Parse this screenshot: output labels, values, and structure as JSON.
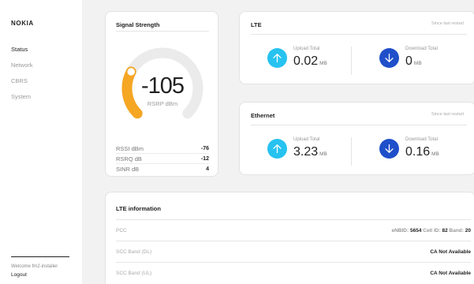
{
  "brand": {
    "logo": "NOKIA"
  },
  "nav": {
    "items": [
      {
        "label": "Status",
        "active": true
      },
      {
        "label": "Network",
        "active": false
      },
      {
        "label": "CBRS",
        "active": false
      },
      {
        "label": "System",
        "active": false
      }
    ]
  },
  "user": {
    "welcome": "Welcome fm2-installer",
    "logout": "Logout"
  },
  "signal": {
    "title": "Signal Strength",
    "rsrp_value": "-105",
    "rsrp_unit": "RSRP dBm",
    "gauge_fraction": 0.27,
    "metrics": [
      {
        "label": "RSSI dBm",
        "value": "-76"
      },
      {
        "label": "RSRQ dB",
        "value": "-12"
      },
      {
        "label": "SINR dB",
        "value": "4"
      }
    ]
  },
  "lte": {
    "title": "LTE",
    "since": "Since last restart",
    "upload_label": "Upload Total",
    "upload_value": "0.02",
    "upload_unit": "MB",
    "download_label": "Download Total",
    "download_value": "0",
    "download_unit": "MB"
  },
  "ethernet": {
    "title": "Ethernet",
    "since": "Since last restart",
    "upload_label": "Upload Total",
    "upload_value": "3.23",
    "upload_unit": "MB",
    "download_label": "Download Total",
    "download_value": "0.16",
    "download_unit": "MB"
  },
  "lte_info": {
    "title": "LTE information",
    "pcc_label": "PCC",
    "pcc": {
      "enbid_key": "eNBID:",
      "enbid_value": "5654",
      "cellid_key": "Cell ID:",
      "cellid_value": "82",
      "band_key": "Band:",
      "band_value": "20"
    },
    "scc_dl_label": "SCC Band (DL)",
    "scc_dl_value": "CA Not Available",
    "scc_ul_label": "SCC Band (UL)",
    "scc_ul_value": "CA Not Available"
  },
  "colors": {
    "gauge_track": "#ebebeb",
    "gauge_fill": "#f5a623",
    "upload": "#26c2f0",
    "download": "#1f4fc9"
  },
  "icons": {
    "upload": "arrow-up-icon",
    "download": "arrow-down-icon"
  }
}
